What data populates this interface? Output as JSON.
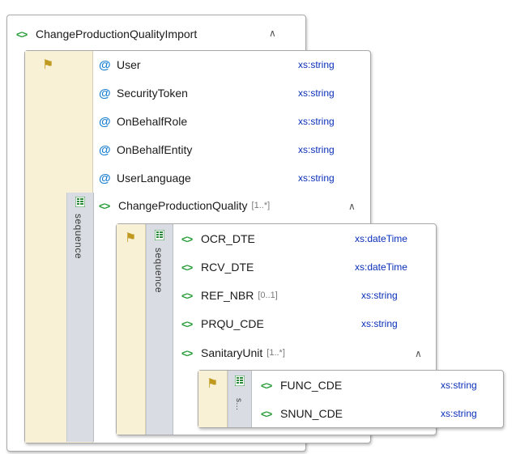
{
  "root": {
    "name": "ChangeProductionQualityImport"
  },
  "attributes": [
    {
      "name": "User",
      "type": "xs:string"
    },
    {
      "name": "SecurityToken",
      "type": "xs:string"
    },
    {
      "name": "OnBehalfRole",
      "type": "xs:string"
    },
    {
      "name": "OnBehalfEntity",
      "type": "xs:string"
    },
    {
      "name": "UserLanguage",
      "type": "xs:string"
    }
  ],
  "sequence_label": "sequence",
  "sequence_label_short": "s...",
  "cpq": {
    "name": "ChangeProductionQuality",
    "occurs": "[1..*]",
    "children": [
      {
        "name": "OCR_DTE",
        "occurs": "",
        "type": "xs:dateTime"
      },
      {
        "name": "RCV_DTE",
        "occurs": "",
        "type": "xs:dateTime"
      },
      {
        "name": "REF_NBR",
        "occurs": "[0..1]",
        "type": "xs:string"
      },
      {
        "name": "PRQU_CDE",
        "occurs": "",
        "type": "xs:string"
      }
    ]
  },
  "sanitary": {
    "name": "SanitaryUnit",
    "occurs": "[1..*]",
    "children": [
      {
        "name": "FUNC_CDE",
        "type": "xs:string"
      },
      {
        "name": "SNUN_CDE",
        "type": "xs:string"
      }
    ]
  },
  "icons": {
    "element": "element-icon",
    "attribute": "attribute-icon",
    "attribute_group": "attribute-group-icon",
    "sequence": "sequence-icon",
    "collapse": "collapse-chevron-icon"
  },
  "colors": {
    "type_text": "#0a2fb8",
    "attribute_icon": "#1a7fd1",
    "element_icon": "#2a9d3a",
    "attribute_column": "#f8f1d6",
    "sequence_column": "#d9dde3"
  }
}
